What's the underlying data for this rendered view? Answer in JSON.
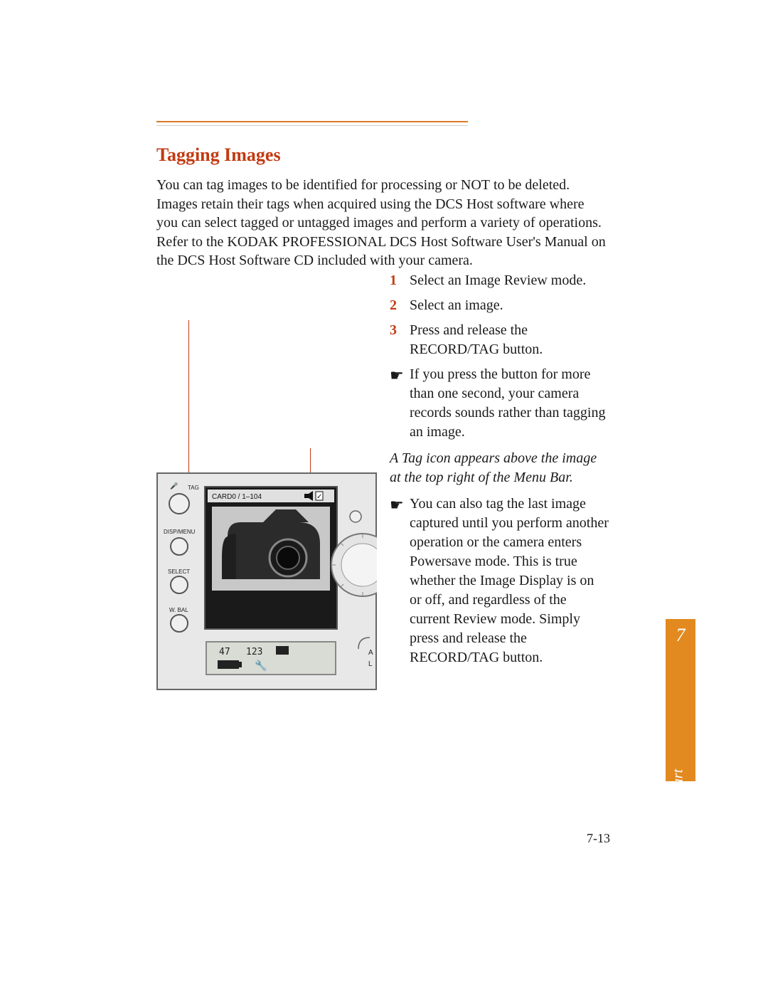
{
  "heading": "Tagging Images",
  "intro_parts": {
    "p1a": "You can tag images to be identified for processing or ",
    "not": "NOT",
    "p1b": " to be deleted. Images retain their tags when acquired using the DCS Host software where you can select tagged or untagged images and perform a variety of operations. Refer to the KODAK PROFESSIONAL DCS Host Software User's Manual on the DCS Host Software CD included with your camera."
  },
  "steps": {
    "s1_num": "1",
    "s1_text": "Select an Image Review mode.",
    "s2_num": "2",
    "s2_text": "Select an image.",
    "s3_num": "3",
    "s3_text": "Press and release the RECORD/TAG button.",
    "note1_bullet": "☛",
    "note1_text": "If you press the button for more than one second, your camera records sounds rather than tagging an image.",
    "italic_note": "A Tag icon appears above the image at the top right of the Menu Bar.",
    "note2_bullet": "☛",
    "note2_text": "You can also tag the last image captured until you perform another operation or the camera enters Powersave mode. This is true whether the Image Display is on or off, and regardless of the current Review mode. Simply press and release the RECORD/TAG button."
  },
  "camera": {
    "labels": {
      "tag": "TAG",
      "dispmenu": "DISP/MENU",
      "select": "SELECT",
      "wbal": "W. BAL",
      "menubar": "CARD0 / 1–104",
      "lcd_left": "47",
      "lcd_mid": "123"
    },
    "side_right": {
      "a": "A",
      "l": "L"
    }
  },
  "side_tab": {
    "chapter_num": "7",
    "chapter_label": "Quick Start"
  },
  "page_number": "7-13"
}
